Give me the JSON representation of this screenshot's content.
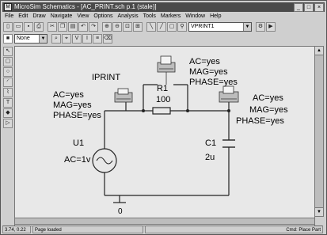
{
  "window": {
    "app_icon": "M",
    "title": "MicroSim Schematics - [AC_PRINT.sch p.1 (stale)]",
    "controls": {
      "minimize": "_",
      "maximize": "□",
      "close": "×"
    }
  },
  "menu": [
    "File",
    "Edit",
    "Draw",
    "Navigate",
    "View",
    "Options",
    "Analysis",
    "Tools",
    "Markers",
    "Window",
    "Help"
  ],
  "toolbar1": {
    "part_combo_value": "VPRINT1"
  },
  "toolbar2": {
    "color_combo_value": "None"
  },
  "schematic": {
    "iprint": {
      "name": "IPRINT",
      "ac": "AC=yes",
      "mag": "MAG=yes",
      "phase": "PHASE=yes"
    },
    "vprint_top": {
      "ac": "AC=yes",
      "mag": "MAG=yes",
      "phase": "PHASE=yes"
    },
    "vprint_right": {
      "ac": "AC=yes",
      "mag": "MAG=yes",
      "phase": "PHASE=yes"
    },
    "r1": {
      "name": "R1",
      "value": "100"
    },
    "u1": {
      "name": "U1",
      "value": "AC=1v"
    },
    "c1": {
      "name": "C1",
      "value": "2u"
    },
    "ground": {
      "label": "0"
    }
  },
  "status": {
    "coords": "3.74, 0.22",
    "message": "Page loaded",
    "mode": "Cmd: Place Part"
  },
  "icons": [
    "app-icon",
    "new-icon",
    "open-icon",
    "save-icon",
    "print-icon",
    "cut-icon",
    "copy-icon",
    "paste-icon",
    "undo-icon",
    "redo-icon",
    "zoom-in-icon",
    "zoom-out-icon",
    "zoom-area-icon",
    "zoom-fit-icon",
    "wire-icon",
    "bus-icon",
    "block-icon",
    "get-part-icon",
    "setup-icon",
    "simulate-icon",
    "probe-icon"
  ]
}
